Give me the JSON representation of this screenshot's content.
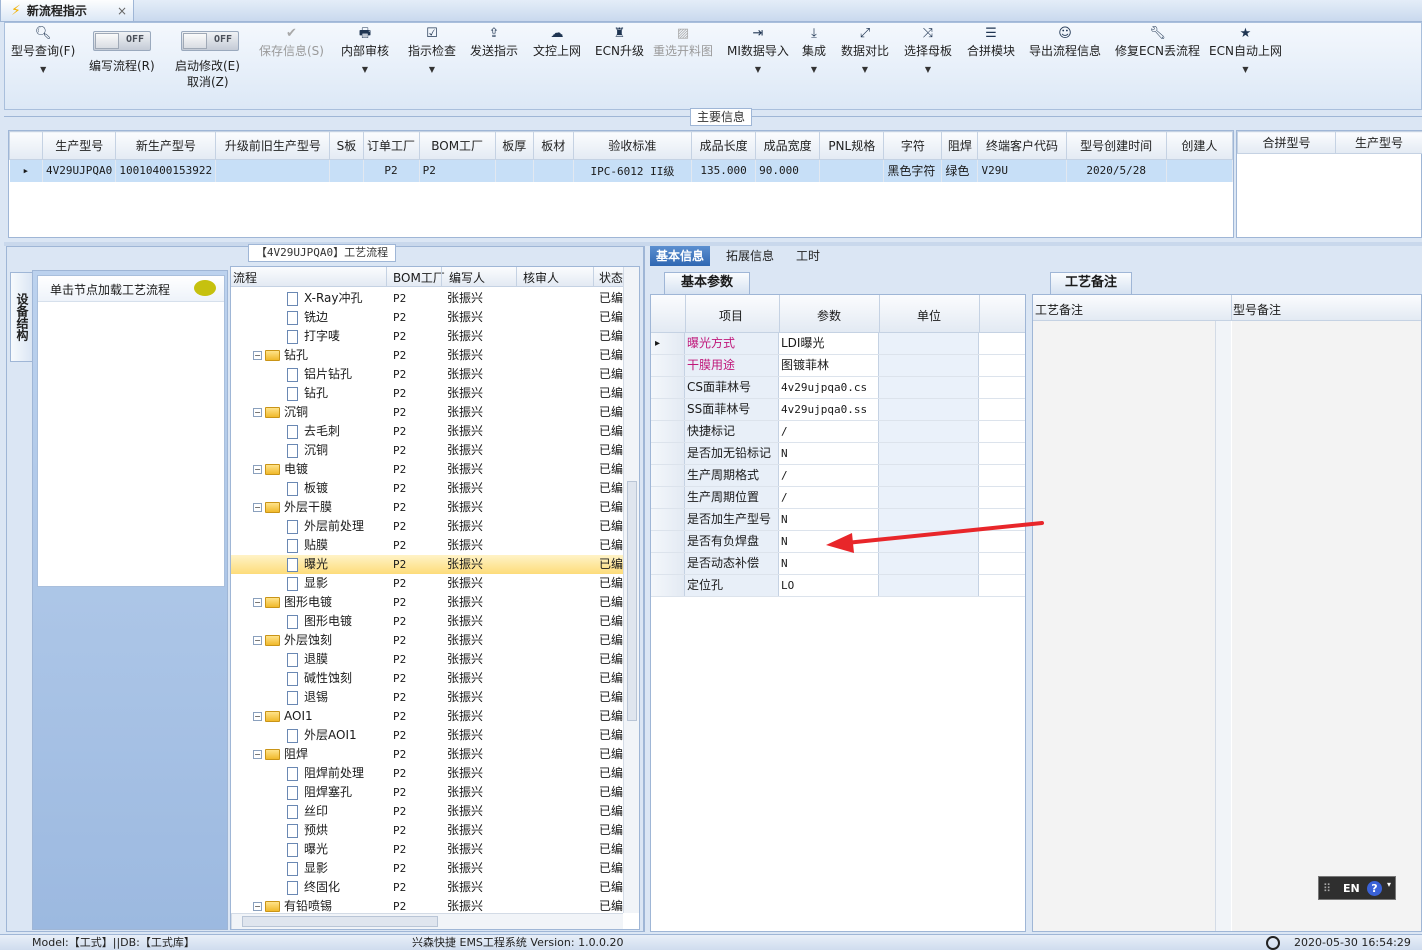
{
  "window": {
    "tab_title": "新流程指示",
    "close": "×"
  },
  "toolbar": {
    "query": {
      "label": "型号查询(F)",
      "icon": "search-icon"
    },
    "write_flow": {
      "label": "编写流程(R)",
      "state": "OFF"
    },
    "start_modify": {
      "label": "启动修改(E)",
      "label2": "取消(Z)",
      "state": "OFF"
    },
    "save_info": {
      "label": "保存信息(S)",
      "icon": "check-icon"
    },
    "internal_review": {
      "label": "内部审核",
      "icon": "printer-icon"
    },
    "instruction_check": {
      "label": "指示检查",
      "icon": "checkbox-icon"
    },
    "send_instruction": {
      "label": "发送指示",
      "icon": "upload-icon"
    },
    "doc_upload": {
      "label": "文控上网",
      "icon": "cloud-upload-icon"
    },
    "ecn_upgrade": {
      "label": "ECN升级",
      "icon": "ecn-icon"
    },
    "reselect_chart": {
      "label": "重选开料图",
      "icon": "image-icon"
    },
    "mi_import": {
      "label": "MI数据导入",
      "icon": "import-icon"
    },
    "integrate": {
      "label": "集成",
      "icon": "download-icon"
    },
    "data_compare": {
      "label": "数据对比",
      "icon": "compare-icon"
    },
    "select_mother": {
      "label": "选择母板",
      "icon": "shuffle-icon"
    },
    "combine_module": {
      "label": "合拼模块",
      "icon": "list-icon"
    },
    "export_flow": {
      "label": "导出流程信息",
      "icon": "smile-icon"
    },
    "fix_ecn": {
      "label": "修复ECN丢流程",
      "icon": "wrench-icon"
    },
    "ecn_auto_upload": {
      "label": "ECN自动上网",
      "icon": "star-icon"
    }
  },
  "main_info": {
    "section_label": "主要信息",
    "columns": [
      "生产型号",
      "新生产型号",
      "升级前旧生产型号",
      "S板",
      "订单工厂",
      "BOM工厂",
      "板厚",
      "板材",
      "验收标准",
      "成品长度",
      "成品宽度",
      "PNL规格",
      "字符",
      "阻焊",
      "终端客户代码",
      "型号创建时间",
      "创建人"
    ],
    "row": [
      "4V29UJPQA0",
      "10010400153922",
      "",
      "",
      "P2",
      "P2",
      "",
      "",
      "IPC-6012 II级",
      "135.000",
      "90.000",
      "",
      "黑色字符",
      "绿色",
      "V29U",
      "2020/5/28",
      ""
    ],
    "side_columns": [
      "合拼型号",
      "生产型号"
    ]
  },
  "left_panel": {
    "side_tab": "设备结构",
    "hint": "单击节点加载工艺流程"
  },
  "process": {
    "title": "【4V29UJPQA0】工艺流程",
    "columns": [
      "流程",
      "BOM工厂",
      "编写人",
      "核审人",
      "状态"
    ],
    "rows": [
      {
        "name": "X-Ray冲孔",
        "type": "item",
        "bom": "P2",
        "author": "张振兴",
        "status": "已编"
      },
      {
        "name": "铣边",
        "type": "item",
        "bom": "P2",
        "author": "张振兴",
        "status": "已编"
      },
      {
        "name": "打字唛",
        "type": "item",
        "bom": "P2",
        "author": "张振兴",
        "status": "已编"
      },
      {
        "name": "钻孔",
        "type": "folder",
        "bom": "P2",
        "author": "张振兴",
        "status": "已编"
      },
      {
        "name": "铝片钻孔",
        "type": "item",
        "bom": "P2",
        "author": "张振兴",
        "status": "已编"
      },
      {
        "name": "钻孔",
        "type": "item",
        "bom": "P2",
        "author": "张振兴",
        "status": "已编"
      },
      {
        "name": "沉铜",
        "type": "folder",
        "bom": "P2",
        "author": "张振兴",
        "status": "已编"
      },
      {
        "name": "去毛刺",
        "type": "item",
        "bom": "P2",
        "author": "张振兴",
        "status": "已编"
      },
      {
        "name": "沉铜",
        "type": "item",
        "bom": "P2",
        "author": "张振兴",
        "status": "已编"
      },
      {
        "name": "电镀",
        "type": "folder",
        "bom": "P2",
        "author": "张振兴",
        "status": "已编"
      },
      {
        "name": "板镀",
        "type": "item",
        "bom": "P2",
        "author": "张振兴",
        "status": "已编"
      },
      {
        "name": "外层干膜",
        "type": "folder",
        "bom": "P2",
        "author": "张振兴",
        "status": "已编"
      },
      {
        "name": "外层前处理",
        "type": "item",
        "bom": "P2",
        "author": "张振兴",
        "status": "已编"
      },
      {
        "name": "贴膜",
        "type": "item",
        "bom": "P2",
        "author": "张振兴",
        "status": "已编"
      },
      {
        "name": "曝光",
        "type": "item",
        "bom": "P2",
        "author": "张振兴",
        "status": "已编",
        "selected": true
      },
      {
        "name": "显影",
        "type": "item",
        "bom": "P2",
        "author": "张振兴",
        "status": "已编"
      },
      {
        "name": "图形电镀",
        "type": "folder",
        "bom": "P2",
        "author": "张振兴",
        "status": "已编"
      },
      {
        "name": "图形电镀",
        "type": "item",
        "bom": "P2",
        "author": "张振兴",
        "status": "已编"
      },
      {
        "name": "外层蚀刻",
        "type": "folder",
        "bom": "P2",
        "author": "张振兴",
        "status": "已编"
      },
      {
        "name": "退膜",
        "type": "item",
        "bom": "P2",
        "author": "张振兴",
        "status": "已编"
      },
      {
        "name": "碱性蚀刻",
        "type": "item",
        "bom": "P2",
        "author": "张振兴",
        "status": "已编"
      },
      {
        "name": "退锡",
        "type": "item",
        "bom": "P2",
        "author": "张振兴",
        "status": "已编"
      },
      {
        "name": "AOI1",
        "type": "folder",
        "bom": "P2",
        "author": "张振兴",
        "status": "已编"
      },
      {
        "name": "外层AOI1",
        "type": "item",
        "bom": "P2",
        "author": "张振兴",
        "status": "已编"
      },
      {
        "name": "阻焊",
        "type": "folder",
        "bom": "P2",
        "author": "张振兴",
        "status": "已编"
      },
      {
        "name": "阻焊前处理",
        "type": "item",
        "bom": "P2",
        "author": "张振兴",
        "status": "已编"
      },
      {
        "name": "阻焊塞孔",
        "type": "item",
        "bom": "P2",
        "author": "张振兴",
        "status": "已编"
      },
      {
        "name": "丝印",
        "type": "item",
        "bom": "P2",
        "author": "张振兴",
        "status": "已编"
      },
      {
        "name": "预烘",
        "type": "item",
        "bom": "P2",
        "author": "张振兴",
        "status": "已编"
      },
      {
        "name": "曝光",
        "type": "item",
        "bom": "P2",
        "author": "张振兴",
        "status": "已编"
      },
      {
        "name": "显影",
        "type": "item",
        "bom": "P2",
        "author": "张振兴",
        "status": "已编"
      },
      {
        "name": "终固化",
        "type": "item",
        "bom": "P2",
        "author": "张振兴",
        "status": "已编"
      },
      {
        "name": "有铅喷锡",
        "type": "folder",
        "bom": "P2",
        "author": "张振兴",
        "status": "已编"
      }
    ]
  },
  "info_tabs": [
    "基本信息",
    "拓展信息",
    "工时"
  ],
  "basic_params": {
    "tab": "基本参数",
    "columns": [
      "项目",
      "参数",
      "单位"
    ],
    "rows": [
      {
        "key": "曝光方式",
        "value": "LDI曝光",
        "highlight": true
      },
      {
        "key": "干膜用途",
        "value": "图镀菲林",
        "highlight": true
      },
      {
        "key": "CS面菲林号",
        "value": "4v29ujpqa0.cs"
      },
      {
        "key": "SS面菲林号",
        "value": "4v29ujpqa0.ss"
      },
      {
        "key": "快捷标记",
        "value": "/"
      },
      {
        "key": "是否加无铅标记",
        "value": "N"
      },
      {
        "key": "生产周期格式",
        "value": "/"
      },
      {
        "key": "生产周期位置",
        "value": "/"
      },
      {
        "key": "是否加生产型号",
        "value": "N"
      },
      {
        "key": "是否有负焊盘",
        "value": "N"
      },
      {
        "key": "是否动态补偿",
        "value": "N"
      },
      {
        "key": "定位孔",
        "value": "LO"
      }
    ]
  },
  "remarks": {
    "tab": "工艺备注",
    "columns": [
      "工艺备注",
      "型号备注"
    ]
  },
  "ime": {
    "lang": "EN",
    "help": "?"
  },
  "statusbar": {
    "left": "Model:【工式】||DB:【工式库】",
    "center": "兴森快捷 EMS工程系统 Version: 1.0.0.20",
    "right": "2020-05-30 16:54:29"
  },
  "colors": {
    "accent": "#2f67b2",
    "highlight_text": "#c0187a",
    "arrow": "#e8262a",
    "selected_row": "#fddc7a"
  }
}
